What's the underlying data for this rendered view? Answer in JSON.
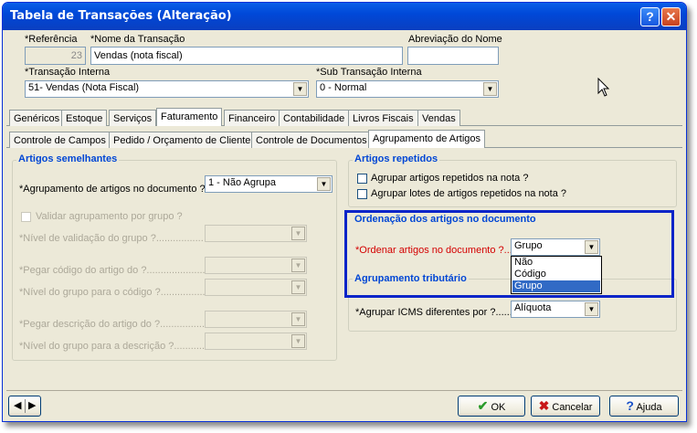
{
  "window": {
    "title": "Tabela de Transações (Alteração)",
    "help_btn": "?",
    "close_btn": "✕"
  },
  "header": {
    "referencia": {
      "label": "*Referência",
      "value": "23"
    },
    "nome": {
      "label": "*Nome da Transação",
      "value": "Vendas (nota fiscal)"
    },
    "abreviacao": {
      "label": "Abreviação do Nome",
      "value": ""
    },
    "transacao_interna": {
      "label": "*Transação Interna",
      "value": "51- Vendas (Nota Fiscal)"
    },
    "sub_transacao": {
      "label": "*Sub Transação Interna",
      "value": "0 - Normal"
    }
  },
  "tabs_top": [
    "Genéricos",
    "Estoque",
    "Serviços",
    "Faturamento",
    "Financeiro",
    "Contabilidade",
    "Livros Fiscais",
    "Vendas"
  ],
  "tabs_sub": [
    "Controle de Campos",
    "Pedido / Orçamento de Cliente",
    "Controle de Documentos",
    "Agrupamento de Artigos"
  ],
  "left": {
    "title": "Artigos semelhantes",
    "agrupamento_label": "*Agrupamento de artigos no documento ?...",
    "agrupamento_value": "1 - Não Agrupa",
    "validar_label": "Validar agrupamento por grupo ?",
    "nivel_validacao_label": "*Nível de validação do grupo ?.................",
    "pegar_codigo_label": "*Pegar código do artigo do ?......................",
    "nivel_codigo_label": "*Nível do grupo para o código ?...................",
    "pegar_descricao_label": "*Pegar descrição do artigo do ?..................",
    "nivel_descricao_label": "*Nível do grupo para a descrição ?..............."
  },
  "right": {
    "repetidos_title": "Artigos repetidos",
    "agrupar_repetidos": "Agrupar artigos repetidos na nota ?",
    "agrupar_lotes": "Agrupar lotes de artigos repetidos na nota ?",
    "ordenacao_title": "Ordenação dos artigos no documento",
    "ordenar_label": "*Ordenar artigos no documento ?.....",
    "ordenar_value": "Grupo",
    "ordenar_options": [
      "Não",
      "Código",
      "Grupo"
    ],
    "tributario_title": "Agrupamento tributário",
    "icms_label": "*Agrupar ICMS diferentes por ?.......",
    "icms_value": "Alíquota"
  },
  "footer": {
    "ok": "OK",
    "cancelar": "Cancelar",
    "ajuda": "Ajuda"
  },
  "colors": {
    "highlight_box": "#0a24c8",
    "selection": "#316ac5",
    "required": "#d40000"
  }
}
